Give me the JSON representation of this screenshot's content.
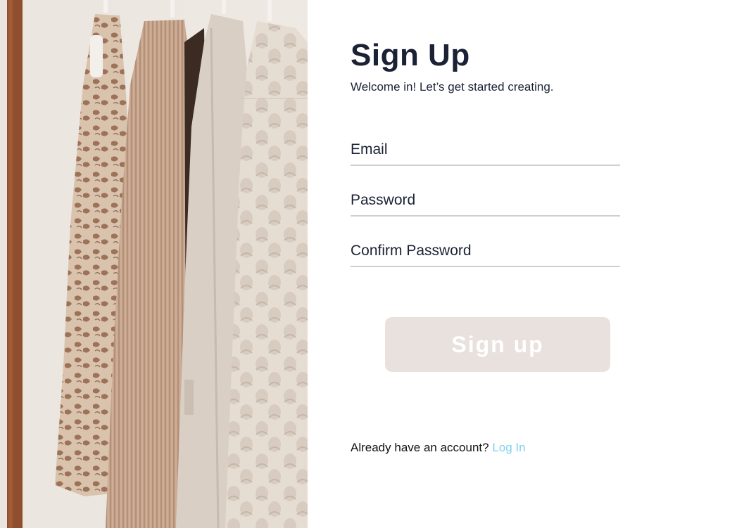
{
  "form": {
    "title": "Sign Up",
    "subtitle": "Welcome in! Let’s get started creating.",
    "fields": [
      {
        "placeholder": "Email",
        "value": ""
      },
      {
        "placeholder": "Password",
        "value": ""
      },
      {
        "placeholder": "Confirm Password",
        "value": ""
      }
    ],
    "submit_label": "Sign up",
    "footer_text": "Already have an account? ",
    "login_link": "Log In"
  },
  "colors": {
    "heading": "#1b2235",
    "button_bg": "#e9e1dd",
    "button_text": "#ffffff",
    "link": "#7fd0ec",
    "underline": "#cfcfcf"
  },
  "photo": {
    "subject": "clothes-on-rack-photo"
  }
}
